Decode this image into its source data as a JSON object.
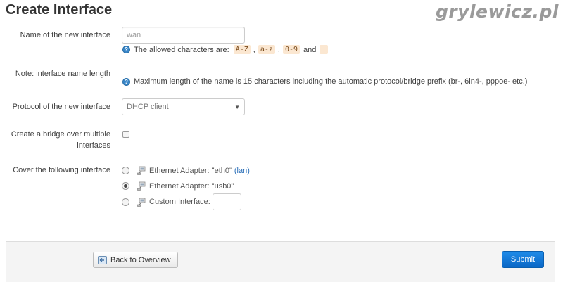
{
  "header": {
    "title": "Create Interface",
    "watermark": "grylewicz.pl"
  },
  "form": {
    "name": {
      "label": "Name of the new interface",
      "value": "wan",
      "help_prefix": "The allowed characters are:",
      "chars": [
        "A-Z",
        "a-z",
        "0-9",
        "_"
      ],
      "sep1": ",",
      "sep2": ",",
      "and": "and"
    },
    "note": {
      "label": "Note: interface name length",
      "text": "Maximum length of the name is 15 characters including the automatic protocol/bridge prefix (br-, 6in4-, pppoe- etc.)"
    },
    "protocol": {
      "label": "Protocol of the new interface",
      "selected": "DHCP client"
    },
    "bridge": {
      "label_line1": "Create a bridge over multiple",
      "label_line2": "interfaces",
      "checked": false
    },
    "cover": {
      "label": "Cover the following interface",
      "options": [
        {
          "label": "Ethernet Adapter: \"eth0\"",
          "link": "(lan)",
          "checked": false
        },
        {
          "label": "Ethernet Adapter: \"usb0\"",
          "checked": true
        },
        {
          "label": "Custom Interface:",
          "checked": false
        }
      ]
    }
  },
  "footer": {
    "back_label": "Back to Overview",
    "submit_label": "Submit"
  }
}
